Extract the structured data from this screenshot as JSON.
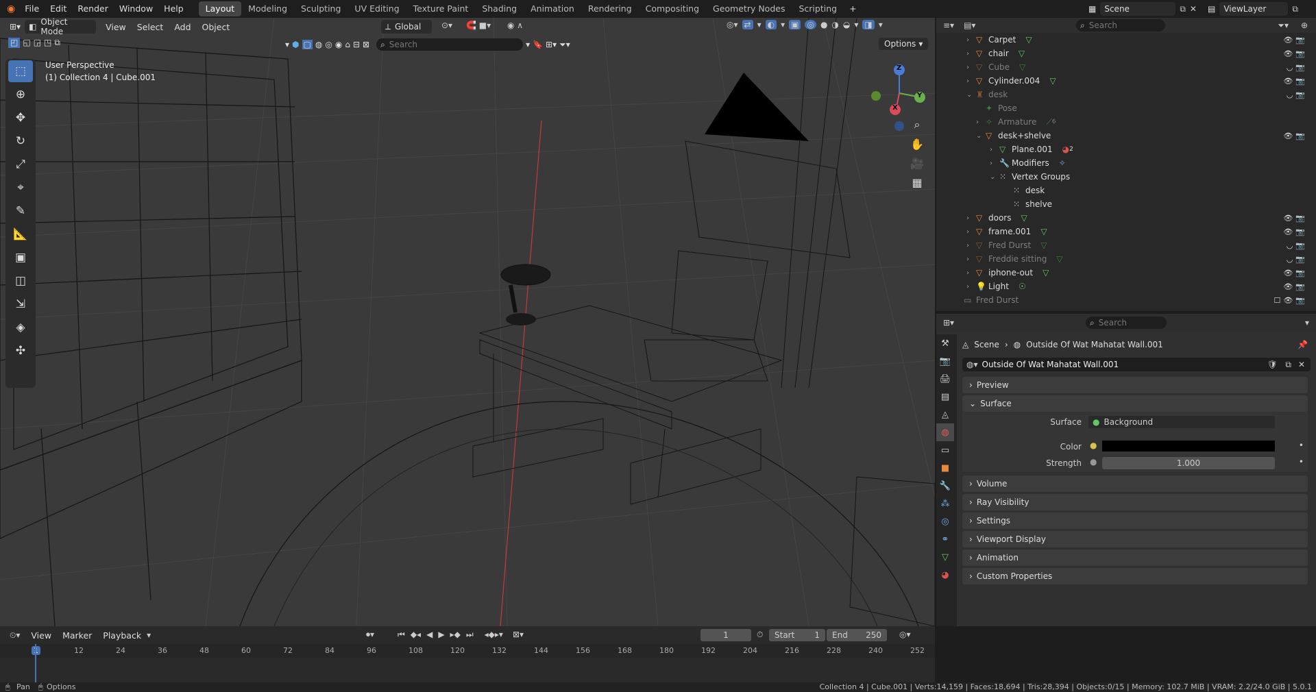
{
  "menus": [
    "File",
    "Edit",
    "Render",
    "Window",
    "Help"
  ],
  "workspaces": [
    "Layout",
    "Modeling",
    "Sculpting",
    "UV Editing",
    "Texture Paint",
    "Shading",
    "Animation",
    "Rendering",
    "Compositing",
    "Geometry Nodes",
    "Scripting"
  ],
  "scene": "Scene",
  "view_layer": "ViewLayer",
  "viewport": {
    "mode": "Object Mode",
    "menu": [
      "View",
      "Select",
      "Add",
      "Object"
    ],
    "orientation": "Global",
    "search_placeholder": "Search",
    "options": "Options",
    "overlay_title": "User Perspective",
    "overlay_sub": "(1) Collection 4 | Cube.001",
    "gizmo_z": "Z",
    "gizmo_y": "Y",
    "gizmo_x": "X"
  },
  "outliner": {
    "search_placeholder": "Search",
    "rows": [
      {
        "label": "Carpet"
      },
      {
        "label": "chair"
      },
      {
        "label": "Cube"
      },
      {
        "label": "Cylinder.004"
      },
      {
        "label": "desk"
      },
      {
        "label": "Pose"
      },
      {
        "label": "Armature"
      },
      {
        "label": "desk+shelve"
      },
      {
        "label": "Plane.001"
      },
      {
        "label": "Modifiers"
      },
      {
        "label": "Vertex Groups"
      },
      {
        "label": "desk"
      },
      {
        "label": "shelve"
      },
      {
        "label": "doors"
      },
      {
        "label": "frame.001"
      },
      {
        "label": "Fred Durst"
      },
      {
        "label": "Freddie sitting"
      },
      {
        "label": "iphone-out"
      },
      {
        "label": "Light"
      },
      {
        "label": "Fred Durst"
      }
    ],
    "badges": {
      "armature": "6",
      "plane": "2"
    }
  },
  "properties": {
    "search_placeholder": "Search",
    "crumb_scene": "Scene",
    "crumb_world": "Outside Of Wat Mahatat Wall.001",
    "world_name": "Outside Of Wat Mahatat Wall.001",
    "panels": [
      "Preview",
      "Surface",
      "Volume",
      "Ray Visibility",
      "Settings",
      "Viewport Display",
      "Animation",
      "Custom Properties"
    ],
    "surface_label": "Surface",
    "surface_value": "Background",
    "color_label": "Color",
    "strength_label": "Strength",
    "strength_value": "1.000"
  },
  "timeline": {
    "menu": [
      "View",
      "Marker",
      "Playback"
    ],
    "current_frame": "1",
    "start_label": "Start",
    "start": "1",
    "end_label": "End",
    "end": "250",
    "ticks": [
      "1",
      "12",
      "24",
      "36",
      "48",
      "60",
      "72",
      "84",
      "96",
      "108",
      "120",
      "132",
      "144",
      "156",
      "168",
      "180",
      "192",
      "204",
      "216",
      "228",
      "240",
      "252"
    ]
  },
  "status": {
    "left1": "Pan",
    "left2": "Options",
    "stats": "Collection 4 | Cube.001 | Verts:14,159 | Faces:18,694 | Tris:28,394 | Objects:0/15 | Memory: 102.7 MiB | VRAM: 2.2/24.0 GiB | 5.0.1"
  },
  "colors": {
    "accent": "#4772b3",
    "mesh": "#e38a3e",
    "data": "#63c863"
  }
}
